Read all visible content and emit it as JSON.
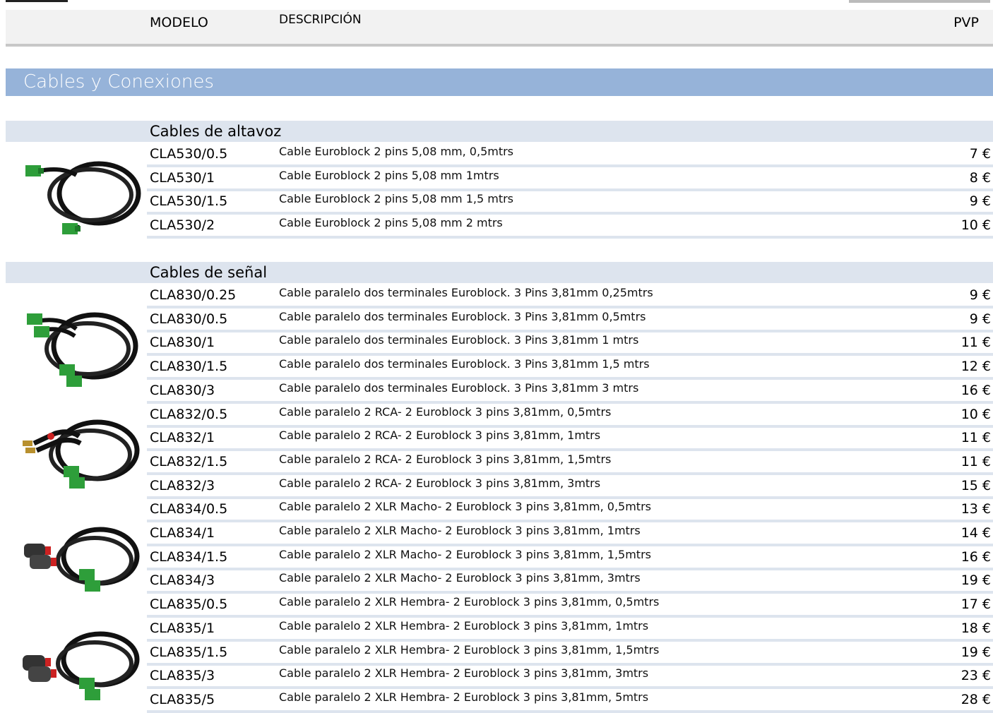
{
  "header": {
    "modelo": "MODELO",
    "descripcion": "DESCRIPCIÓN",
    "pvp": "PVP"
  },
  "section": {
    "title": "Cables y Conexiones"
  },
  "groups": [
    {
      "title": "Cables de altavoz",
      "products": [
        {
          "model": "CLA530/0.5",
          "desc": "Cable Euroblock 2 pins 5,08 mm, 0,5mtrs",
          "price": "7 €"
        },
        {
          "model": "CLA530/1",
          "desc": "Cable Euroblock 2 pins 5,08 mm  1mtrs",
          "price": "8 €"
        },
        {
          "model": "CLA530/1.5",
          "desc": "Cable Euroblock 2 pins 5,08 mm  1,5 mtrs",
          "price": "9 €"
        },
        {
          "model": "CLA530/2",
          "desc": "Cable Euroblock 2 pins 5,08 mm  2  mtrs",
          "price": "10 €"
        }
      ]
    },
    {
      "title": "Cables de señal",
      "products": [
        {
          "model": "CLA830/0.25",
          "desc": "Cable paralelo dos terminales Euroblock. 3 Pins 3,81mm 0,25mtrs",
          "price": "9 €"
        },
        {
          "model": "CLA830/0.5",
          "desc": "Cable paralelo dos terminales Euroblock. 3 Pins 3,81mm 0,5mtrs",
          "price": "9 €"
        },
        {
          "model": "CLA830/1",
          "desc": "Cable paralelo dos terminales Euroblock. 3 Pins 3,81mm 1 mtrs",
          "price": "11 €"
        },
        {
          "model": "CLA830/1.5",
          "desc": "Cable paralelo dos terminales Euroblock. 3 Pins 3,81mm 1,5 mtrs",
          "price": "12 €"
        },
        {
          "model": "CLA830/3",
          "desc": "Cable paralelo dos terminales Euroblock. 3 Pins 3,81mm 3 mtrs",
          "price": "16 €"
        },
        {
          "model": "CLA832/0.5",
          "desc": "Cable paralelo 2 RCA- 2 Euroblock 3 pins 3,81mm, 0,5mtrs",
          "price": "10 €"
        },
        {
          "model": "CLA832/1",
          "desc": "Cable paralelo 2 RCA- 2 Euroblock 3 pins 3,81mm, 1mtrs",
          "price": "11 €"
        },
        {
          "model": "CLA832/1.5",
          "desc": "Cable paralelo 2 RCA- 2 Euroblock 3 pins 3,81mm, 1,5mtrs",
          "price": "11 €"
        },
        {
          "model": "CLA832/3",
          "desc": "Cable paralelo 2 RCA- 2 Euroblock 3 pins 3,81mm, 3mtrs",
          "price": "15 €"
        },
        {
          "model": "CLA834/0.5",
          "desc": "Cable paralelo 2 XLR Macho- 2 Euroblock 3 pins 3,81mm, 0,5mtrs",
          "price": "13 €"
        },
        {
          "model": "CLA834/1",
          "desc": "Cable paralelo 2 XLR Macho- 2 Euroblock 3 pins 3,81mm, 1mtrs",
          "price": "14 €"
        },
        {
          "model": "CLA834/1.5",
          "desc": "Cable paralelo 2 XLR Macho- 2 Euroblock 3 pins 3,81mm, 1,5mtrs",
          "price": "16 €"
        },
        {
          "model": "CLA834/3",
          "desc": "Cable paralelo 2 XLR Macho- 2 Euroblock 3 pins 3,81mm, 3mtrs",
          "price": "19 €"
        },
        {
          "model": "CLA835/0.5",
          "desc": "Cable paralelo 2 XLR Hembra- 2 Euroblock 3 pins 3,81mm, 0,5mtrs",
          "price": "17 €"
        },
        {
          "model": "CLA835/1",
          "desc": "Cable paralelo 2 XLR Hembra- 2 Euroblock 3 pins 3,81mm, 1mtrs",
          "price": "18 €"
        },
        {
          "model": "CLA835/1.5",
          "desc": "Cable paralelo 2 XLR Hembra- 2 Euroblock 3 pins 3,81mm, 1,5mtrs",
          "price": "19 €"
        },
        {
          "model": "CLA835/3",
          "desc": "Cable paralelo 2 XLR Hembra- 2 Euroblock 3 pins 3,81mm, 3mtrs",
          "price": "23 €"
        },
        {
          "model": "CLA835/5",
          "desc": "Cable paralelo 2 XLR Hembra- 2 Euroblock 3 pins 3,81mm, 5mtrs",
          "price": "28 €"
        }
      ]
    }
  ],
  "images": [
    {
      "icon": "euroblock-2pin-cable-icon"
    },
    {
      "icon": "euroblock-parallel-cable-icon"
    },
    {
      "icon": "rca-euroblock-cable-icon"
    },
    {
      "icon": "xlr-male-euroblock-cable-icon"
    },
    {
      "icon": "xlr-female-euroblock-cable-icon"
    }
  ],
  "colors": {
    "section_band": "#96b3d9",
    "group_band": "#dde4ee",
    "connector_green": "#2e9e3a"
  }
}
